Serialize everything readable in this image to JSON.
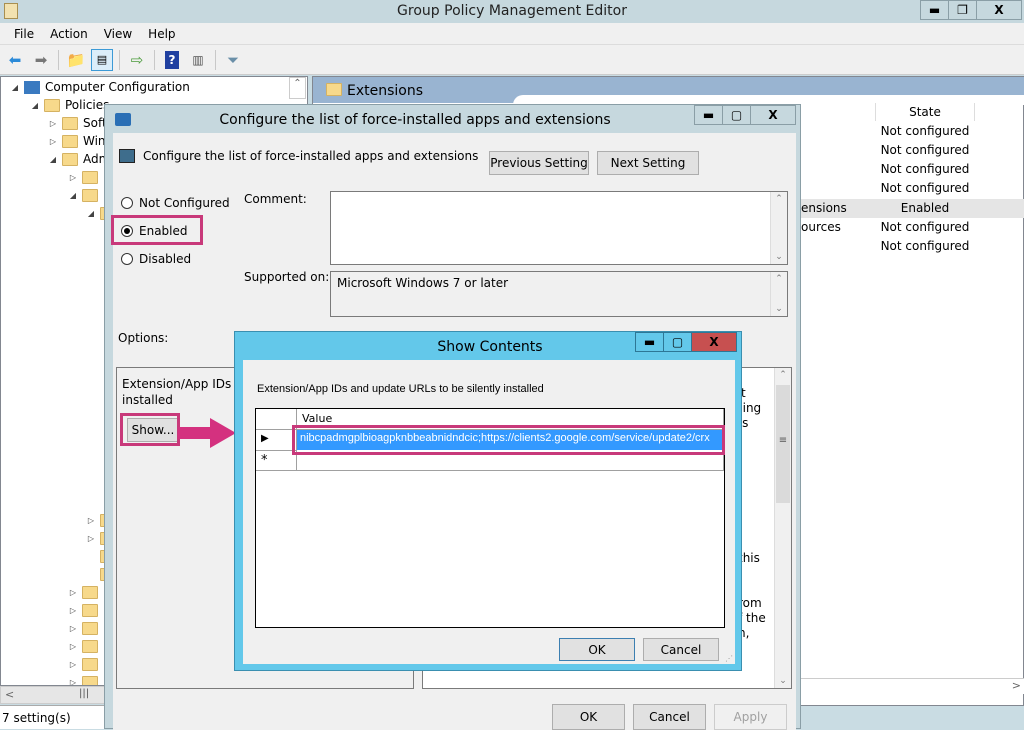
{
  "window": {
    "title": "Group Policy Management Editor",
    "controls": [
      "minimize",
      "restore",
      "close"
    ]
  },
  "menu": [
    "File",
    "Action",
    "View",
    "Help"
  ],
  "toolbar": [
    "back-icon",
    "forward-icon",
    "up-folder-icon",
    "show-hide-tree-icon",
    "export-list-icon",
    "help-icon",
    "show-action-pane-icon",
    "filter-icon"
  ],
  "tree": {
    "root": "Computer Configuration",
    "policies": "Policies",
    "items": [
      "Soft",
      "Win",
      "Adm"
    ]
  },
  "status": {
    "text": "7 setting(s)"
  },
  "right_pane": {
    "header": "Extensions",
    "state_header": "State",
    "rows": [
      {
        "name": "",
        "state": "Not configured"
      },
      {
        "name": "",
        "state": "Not configured"
      },
      {
        "name": "",
        "state": "Not configured"
      },
      {
        "name": "",
        "state": "Not configured"
      },
      {
        "name": "ensions",
        "state": "Enabled"
      },
      {
        "name": "ources",
        "state": "Not configured"
      },
      {
        "name": "",
        "state": "Not configured"
      }
    ]
  },
  "policy_dialog": {
    "title": "Configure the list of force-installed apps and extensions",
    "heading": "Configure the list of force-installed apps and extensions",
    "previous_setting": "Previous Setting",
    "next_setting": "Next Setting",
    "options": [
      {
        "label": "Not Configured",
        "selected": false
      },
      {
        "label": "Enabled",
        "selected": true
      },
      {
        "label": "Disabled",
        "selected": false
      }
    ],
    "comment_label": "Comment:",
    "comment_value": "",
    "supported_label": "Supported on:",
    "supported_value": "Microsoft Windows 7 or later",
    "options_label": "Options:",
    "option_text_1": "Extension/App IDs an",
    "option_text_2": "installed",
    "show_button": "Show...",
    "help_fragments": [
      "t",
      "ding",
      "ys",
      "this",
      "rom",
      "f the",
      "n,"
    ],
    "ok": "OK",
    "cancel": "Cancel",
    "apply": "Apply"
  },
  "show_contents": {
    "title": "Show Contents",
    "description": "Extension/App IDs and update URLs to be silently installed",
    "column_header": "Value",
    "rows": [
      "nibcpadmgplbioagpknbbeabnidndcic;https://clients2.google.com/service/update2/crx"
    ],
    "new_row_marker": "*",
    "ok": "OK",
    "cancel": "Cancel"
  },
  "highlight_color": "#c8397a"
}
